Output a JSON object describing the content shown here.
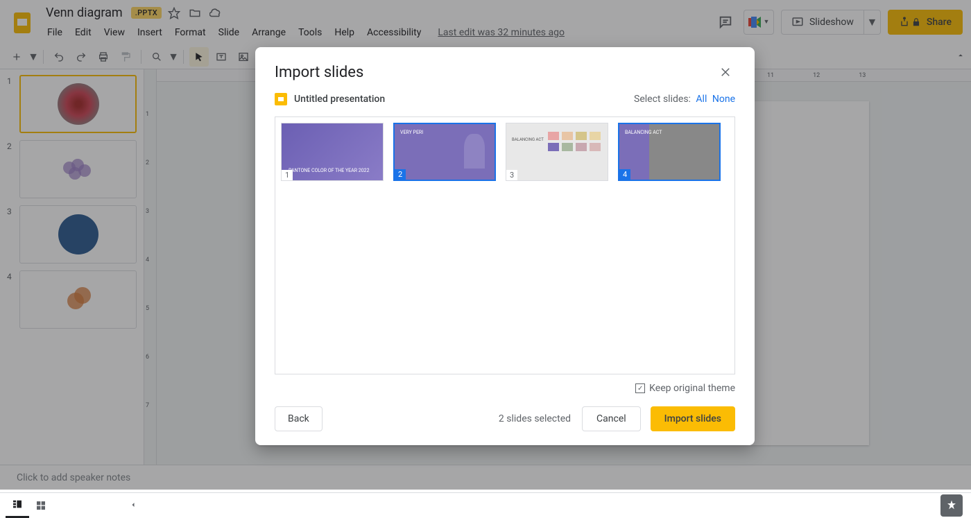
{
  "title": {
    "docName": "Venn diagram",
    "pptxBadge": ".PPTX",
    "lastEdit": "Last edit was 32 minutes ago"
  },
  "menu": {
    "file": "File",
    "edit": "Edit",
    "view": "View",
    "insert": "Insert",
    "format": "Format",
    "slide": "Slide",
    "arrange": "Arrange",
    "tools": "Tools",
    "help": "Help",
    "accessibility": "Accessibility"
  },
  "header": {
    "slideshow": "Slideshow",
    "share": "Share"
  },
  "filmstrip": {
    "slides": [
      {
        "num": "1"
      },
      {
        "num": "2"
      },
      {
        "num": "3"
      },
      {
        "num": "4"
      }
    ]
  },
  "ruler_h": [
    "11",
    "12",
    "13"
  ],
  "ruler_v": [
    "1",
    "2",
    "3",
    "4",
    "5",
    "6",
    "7"
  ],
  "notes": {
    "placeholder": "Click to add speaker notes"
  },
  "dialog": {
    "title": "Import slides",
    "presentationName": "Untitled presentation",
    "selectLabel": "Select slides:",
    "all": "All",
    "none": "None",
    "slides": [
      {
        "num": "1",
        "selected": false,
        "label": "PANTONE COLOR OF THE YEAR 2022"
      },
      {
        "num": "2",
        "selected": true,
        "label": "VERY PERI"
      },
      {
        "num": "3",
        "selected": false,
        "label": "BALANCING ACT"
      },
      {
        "num": "4",
        "selected": true,
        "label": "BALANCING ACT"
      }
    ],
    "keepTheme": "Keep original theme",
    "keepThemeChecked": true,
    "back": "Back",
    "selectedCount": "2 slides selected",
    "cancel": "Cancel",
    "import": "Import slides"
  }
}
